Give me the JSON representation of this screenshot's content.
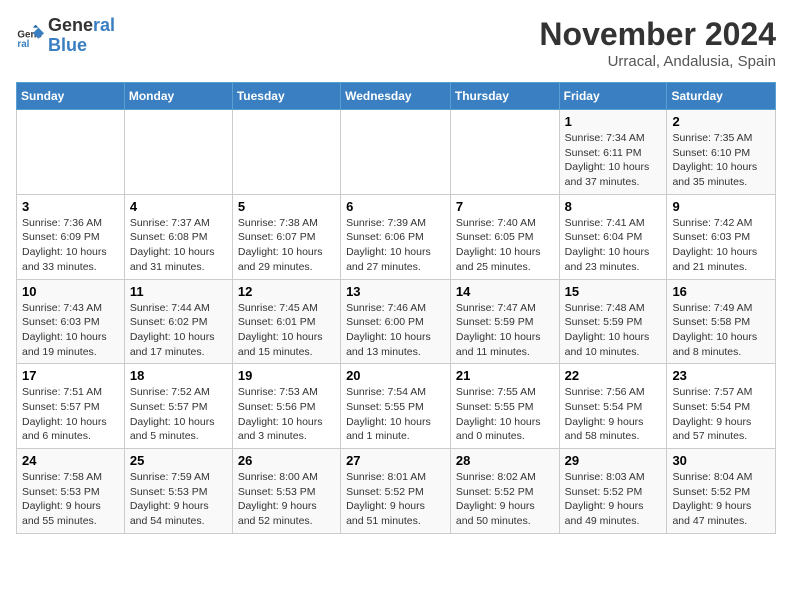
{
  "logo": {
    "line1": "General",
    "line2": "Blue"
  },
  "title": "November 2024",
  "location": "Urracal, Andalusia, Spain",
  "days_of_week": [
    "Sunday",
    "Monday",
    "Tuesday",
    "Wednesday",
    "Thursday",
    "Friday",
    "Saturday"
  ],
  "weeks": [
    [
      {
        "day": "",
        "info": ""
      },
      {
        "day": "",
        "info": ""
      },
      {
        "day": "",
        "info": ""
      },
      {
        "day": "",
        "info": ""
      },
      {
        "day": "",
        "info": ""
      },
      {
        "day": "1",
        "info": "Sunrise: 7:34 AM\nSunset: 6:11 PM\nDaylight: 10 hours and 37 minutes."
      },
      {
        "day": "2",
        "info": "Sunrise: 7:35 AM\nSunset: 6:10 PM\nDaylight: 10 hours and 35 minutes."
      }
    ],
    [
      {
        "day": "3",
        "info": "Sunrise: 7:36 AM\nSunset: 6:09 PM\nDaylight: 10 hours and 33 minutes."
      },
      {
        "day": "4",
        "info": "Sunrise: 7:37 AM\nSunset: 6:08 PM\nDaylight: 10 hours and 31 minutes."
      },
      {
        "day": "5",
        "info": "Sunrise: 7:38 AM\nSunset: 6:07 PM\nDaylight: 10 hours and 29 minutes."
      },
      {
        "day": "6",
        "info": "Sunrise: 7:39 AM\nSunset: 6:06 PM\nDaylight: 10 hours and 27 minutes."
      },
      {
        "day": "7",
        "info": "Sunrise: 7:40 AM\nSunset: 6:05 PM\nDaylight: 10 hours and 25 minutes."
      },
      {
        "day": "8",
        "info": "Sunrise: 7:41 AM\nSunset: 6:04 PM\nDaylight: 10 hours and 23 minutes."
      },
      {
        "day": "9",
        "info": "Sunrise: 7:42 AM\nSunset: 6:03 PM\nDaylight: 10 hours and 21 minutes."
      }
    ],
    [
      {
        "day": "10",
        "info": "Sunrise: 7:43 AM\nSunset: 6:03 PM\nDaylight: 10 hours and 19 minutes."
      },
      {
        "day": "11",
        "info": "Sunrise: 7:44 AM\nSunset: 6:02 PM\nDaylight: 10 hours and 17 minutes."
      },
      {
        "day": "12",
        "info": "Sunrise: 7:45 AM\nSunset: 6:01 PM\nDaylight: 10 hours and 15 minutes."
      },
      {
        "day": "13",
        "info": "Sunrise: 7:46 AM\nSunset: 6:00 PM\nDaylight: 10 hours and 13 minutes."
      },
      {
        "day": "14",
        "info": "Sunrise: 7:47 AM\nSunset: 5:59 PM\nDaylight: 10 hours and 11 minutes."
      },
      {
        "day": "15",
        "info": "Sunrise: 7:48 AM\nSunset: 5:59 PM\nDaylight: 10 hours and 10 minutes."
      },
      {
        "day": "16",
        "info": "Sunrise: 7:49 AM\nSunset: 5:58 PM\nDaylight: 10 hours and 8 minutes."
      }
    ],
    [
      {
        "day": "17",
        "info": "Sunrise: 7:51 AM\nSunset: 5:57 PM\nDaylight: 10 hours and 6 minutes."
      },
      {
        "day": "18",
        "info": "Sunrise: 7:52 AM\nSunset: 5:57 PM\nDaylight: 10 hours and 5 minutes."
      },
      {
        "day": "19",
        "info": "Sunrise: 7:53 AM\nSunset: 5:56 PM\nDaylight: 10 hours and 3 minutes."
      },
      {
        "day": "20",
        "info": "Sunrise: 7:54 AM\nSunset: 5:55 PM\nDaylight: 10 hours and 1 minute."
      },
      {
        "day": "21",
        "info": "Sunrise: 7:55 AM\nSunset: 5:55 PM\nDaylight: 10 hours and 0 minutes."
      },
      {
        "day": "22",
        "info": "Sunrise: 7:56 AM\nSunset: 5:54 PM\nDaylight: 9 hours and 58 minutes."
      },
      {
        "day": "23",
        "info": "Sunrise: 7:57 AM\nSunset: 5:54 PM\nDaylight: 9 hours and 57 minutes."
      }
    ],
    [
      {
        "day": "24",
        "info": "Sunrise: 7:58 AM\nSunset: 5:53 PM\nDaylight: 9 hours and 55 minutes."
      },
      {
        "day": "25",
        "info": "Sunrise: 7:59 AM\nSunset: 5:53 PM\nDaylight: 9 hours and 54 minutes."
      },
      {
        "day": "26",
        "info": "Sunrise: 8:00 AM\nSunset: 5:53 PM\nDaylight: 9 hours and 52 minutes."
      },
      {
        "day": "27",
        "info": "Sunrise: 8:01 AM\nSunset: 5:52 PM\nDaylight: 9 hours and 51 minutes."
      },
      {
        "day": "28",
        "info": "Sunrise: 8:02 AM\nSunset: 5:52 PM\nDaylight: 9 hours and 50 minutes."
      },
      {
        "day": "29",
        "info": "Sunrise: 8:03 AM\nSunset: 5:52 PM\nDaylight: 9 hours and 49 minutes."
      },
      {
        "day": "30",
        "info": "Sunrise: 8:04 AM\nSunset: 5:52 PM\nDaylight: 9 hours and 47 minutes."
      }
    ]
  ]
}
